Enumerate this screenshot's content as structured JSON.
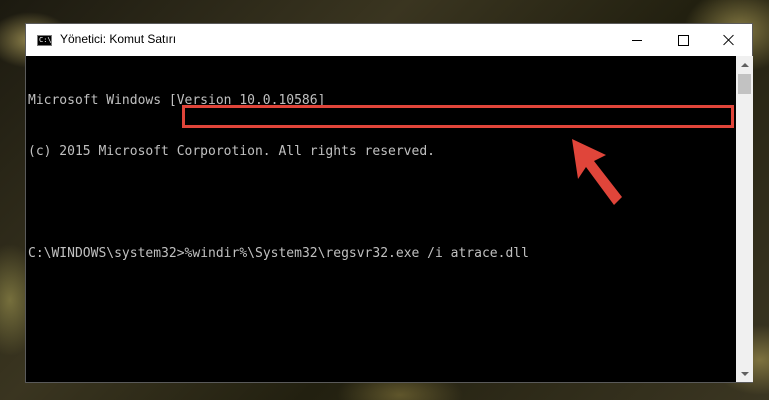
{
  "window": {
    "title": "Yönetici: Komut Satırı",
    "icon": "cmd-icon"
  },
  "console": {
    "lines": [
      "Microsoft Windows [Version 10.0.10586]",
      "(c) 2015 Microsoft Corporotion. All rights reserved.",
      ""
    ],
    "prompt": "C:\\WINDOWS\\system32>",
    "command": "%windir%\\System32\\regsvr32.exe /i atrace.dll"
  },
  "annotation": {
    "highlight_color": "#e0453a",
    "arrow_icon": "red-arrow-icon"
  }
}
